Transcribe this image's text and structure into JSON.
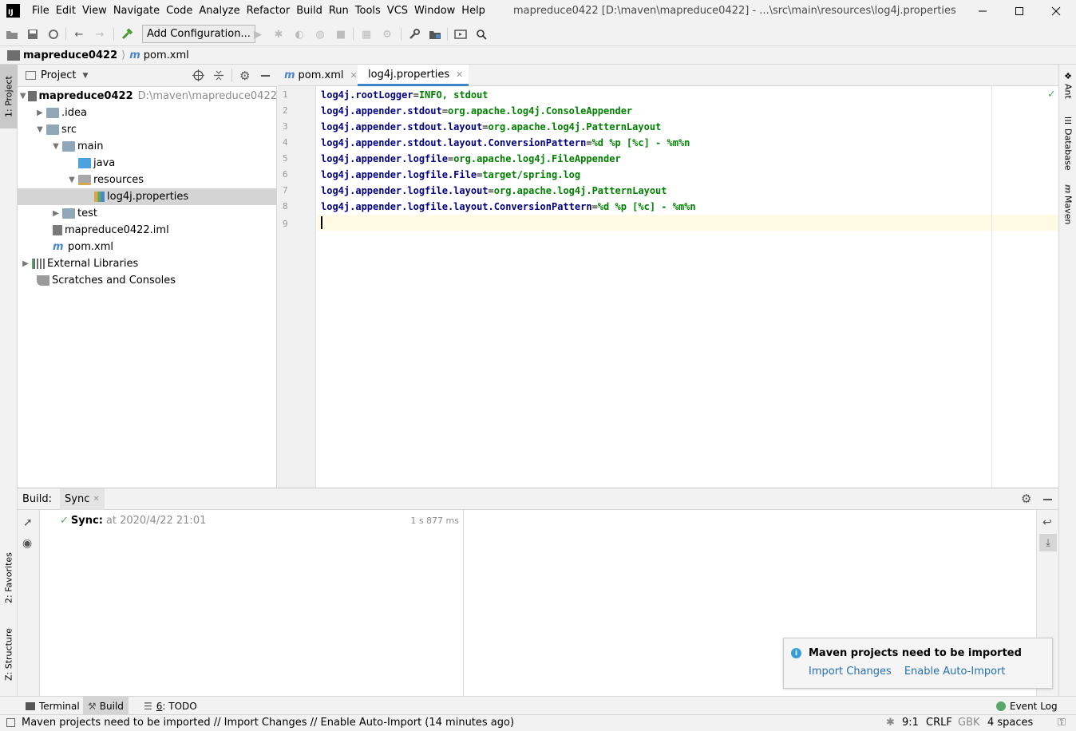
{
  "app": {
    "logo_text": "IJ",
    "window_title": "mapreduce0422 [D:\\maven\\mapreduce0422] - ...\\src\\main\\resources\\log4j.properties"
  },
  "menu": [
    "File",
    "Edit",
    "View",
    "Navigate",
    "Code",
    "Analyze",
    "Refactor",
    "Build",
    "Run",
    "Tools",
    "VCS",
    "Window",
    "Help"
  ],
  "toolbar": {
    "add_configuration_label": "Add Configuration..."
  },
  "navbar": {
    "project": "mapreduce0422",
    "file": "pom.xml"
  },
  "left_strip": {
    "project_tab": "1: Project",
    "favorites_tab": "2: Favorites",
    "structure_tab": "Z: Structure"
  },
  "right_strip": {
    "ant_tab": "Ant",
    "database_tab": "Database",
    "maven_tab": "Maven"
  },
  "project_panel": {
    "title": "Project",
    "tree": [
      {
        "label": "mapreduce0422",
        "path": "D:\\maven\\mapreduce0422",
        "bold": true
      },
      {
        "label": ".idea"
      },
      {
        "label": "src"
      },
      {
        "label": "main"
      },
      {
        "label": "java"
      },
      {
        "label": "resources"
      },
      {
        "label": "log4j.properties",
        "selected": true
      },
      {
        "label": "test"
      },
      {
        "label": "mapreduce0422.iml"
      },
      {
        "label": "pom.xml"
      },
      {
        "label": "External Libraries"
      },
      {
        "label": "Scratches and Consoles"
      }
    ]
  },
  "editor": {
    "tabs": [
      {
        "label": "pom.xml",
        "active": false
      },
      {
        "label": "log4j.properties",
        "active": true
      }
    ],
    "line_numbers": [
      "1",
      "2",
      "3",
      "4",
      "5",
      "6",
      "7",
      "8",
      "9"
    ],
    "lines": [
      {
        "key": "log4j.rootLogger",
        "eq": "=",
        "value": "INFO, stdout"
      },
      {
        "key": "log4j.appender.stdout",
        "eq": "=",
        "value": "org.apache.log4j.ConsoleAppender"
      },
      {
        "key": "log4j.appender.stdout.layout",
        "eq": "=",
        "value": "org.apache.log4j.PatternLayout"
      },
      {
        "key": "log4j.appender.stdout.layout.ConversionPattern",
        "eq": "=",
        "value": "%d %p [%c] - %m%n"
      },
      {
        "key": "log4j.appender.logfile",
        "eq": "=",
        "value": "org.apache.log4j.FileAppender"
      },
      {
        "key": "log4j.appender.logfile.File",
        "eq": "=",
        "value": "target/spring.log"
      },
      {
        "key": "log4j.appender.logfile.layout",
        "eq": "=",
        "value": "org.apache.log4j.PatternLayout"
      },
      {
        "key": "log4j.appender.logfile.layout.ConversionPattern",
        "eq": "=",
        "value": "%d %p [%c] - %m%n"
      }
    ]
  },
  "build_panel": {
    "label": "Build:",
    "tab": "Sync",
    "sync_label": "Sync:",
    "sync_time": "at 2020/4/22 21:01",
    "duration": "1 s 877 ms"
  },
  "notification": {
    "title": "Maven projects need to be imported",
    "action_import": "Import Changes",
    "action_auto": "Enable Auto-Import"
  },
  "bottom_tabs": {
    "terminal": "Terminal",
    "build": "Build",
    "todo_num": "6",
    "todo": ": TODO",
    "event_log": "Event Log"
  },
  "status_bar": {
    "message": "Maven projects need to be imported // Import Changes // Enable Auto-Import (14 minutes ago)",
    "position": "9:1",
    "line_sep": "CRLF",
    "encoding": "GBK",
    "indent": "4 spaces"
  },
  "colors": {
    "key": "#000080",
    "value": "#008000",
    "accent": "#4083c9",
    "link": "#2470b3",
    "success": "#59a869"
  }
}
